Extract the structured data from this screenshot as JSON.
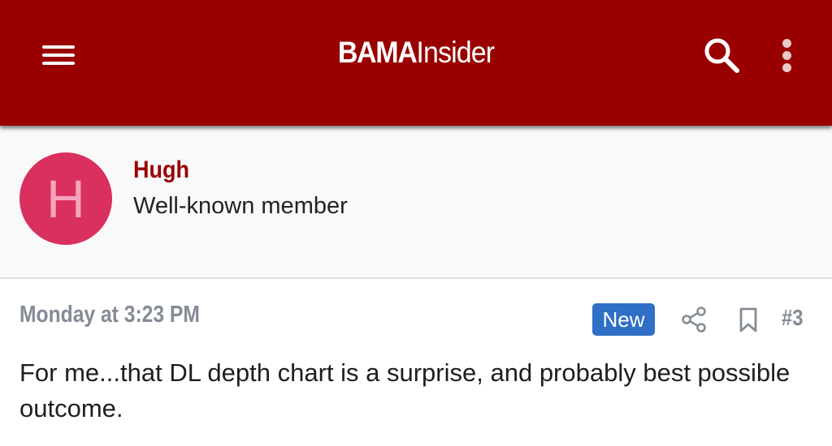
{
  "header": {
    "logo_bold": "BAMA",
    "logo_regular": "Insider",
    "menu_icon": "hamburger-menu-icon",
    "search_icon": "search-icon",
    "more_icon": "more-vertical-icon",
    "background": "#990000"
  },
  "author": {
    "avatar_letter": "H",
    "avatar_color": "#d9305f",
    "name": "Hugh",
    "title": "Well-known member"
  },
  "post": {
    "date": "Monday at 3:23 PM",
    "badge": "New",
    "number": "#3",
    "share_icon": "share-icon",
    "bookmark_icon": "bookmark-icon",
    "body": "For me...that DL depth chart is a surprise, and probably best possible outcome."
  }
}
